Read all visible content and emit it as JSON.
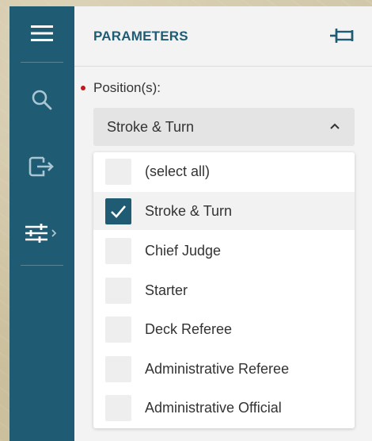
{
  "panel": {
    "title": "PARAMETERS"
  },
  "sidebar": {
    "items": [
      {
        "icon": "menu-icon"
      },
      {
        "icon": "search-icon"
      },
      {
        "icon": "logout-icon"
      },
      {
        "icon": "sliders-icon"
      }
    ]
  },
  "parameter": {
    "label": "Position(s):",
    "required": true,
    "selected_value": "Stroke & Turn"
  },
  "dropdown": {
    "options": [
      {
        "label": "(select all)",
        "checked": false
      },
      {
        "label": "Stroke & Turn",
        "checked": true
      },
      {
        "label": "Chief Judge",
        "checked": false
      },
      {
        "label": "Starter",
        "checked": false
      },
      {
        "label": "Deck Referee",
        "checked": false
      },
      {
        "label": "Administrative Referee",
        "checked": false
      },
      {
        "label": "Administrative Official",
        "checked": false
      }
    ]
  },
  "colors": {
    "sidebar": "#1f5b73",
    "accent": "#1f5b73",
    "required": "#c0181e"
  }
}
